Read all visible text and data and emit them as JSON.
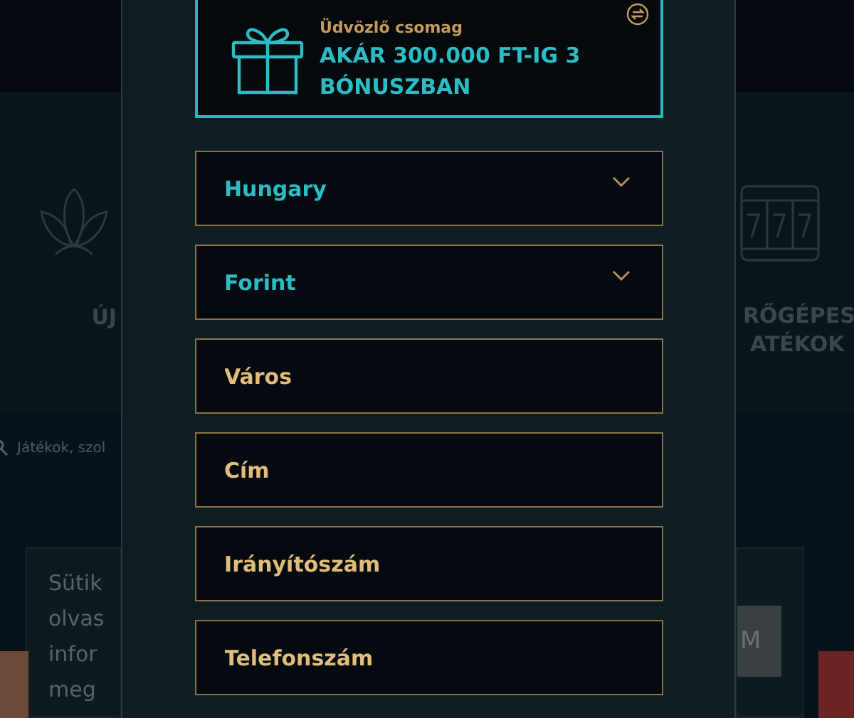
{
  "background": {
    "left": {
      "category_label": "ÚJ",
      "search_placeholder": "Játékok, szol",
      "cookie_lines": [
        "Sütik",
        "olvas",
        "infor",
        "meg"
      ]
    },
    "right": {
      "category_label_lines": [
        "RŐGÉPES",
        "ATÉKOK"
      ],
      "cookie_button": "M"
    }
  },
  "bonus": {
    "subtitle": "Üdvözlő csomag",
    "title": "AKÁR 300.000 FT-IG 3 BÓNUSZBAN"
  },
  "fields": [
    {
      "kind": "select",
      "value": "Hungary"
    },
    {
      "kind": "select",
      "value": "Forint"
    },
    {
      "kind": "input",
      "placeholder": "Város"
    },
    {
      "kind": "input",
      "placeholder": "Cím"
    },
    {
      "kind": "input",
      "placeholder": "Irányítószám"
    },
    {
      "kind": "input",
      "placeholder": "Telefonszám"
    }
  ]
}
